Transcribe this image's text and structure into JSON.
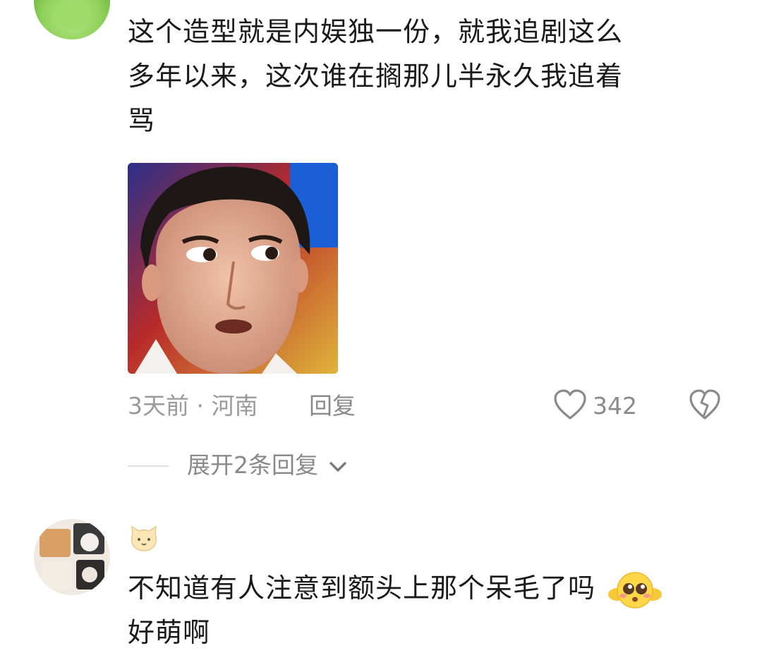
{
  "comment1": {
    "lines": [
      "这个造型就是内娱独一份，就我追剧这么",
      "多年以来，这次谁在搁那儿半永久我追着",
      "骂"
    ],
    "time": "3天前",
    "separator": "·",
    "location": "河南",
    "reply_label": "回复",
    "like_count": "342",
    "expand_label": "展开2条回复"
  },
  "comment2": {
    "name_badge_icon": "cat-face",
    "lines": [
      "不知道有人注意到额头上那个呆毛了吗",
      "好萌啊"
    ],
    "emoji": "pleading-face"
  },
  "colors": {
    "meta_gray": "#9a9a9a",
    "text": "#1a1a1a"
  }
}
